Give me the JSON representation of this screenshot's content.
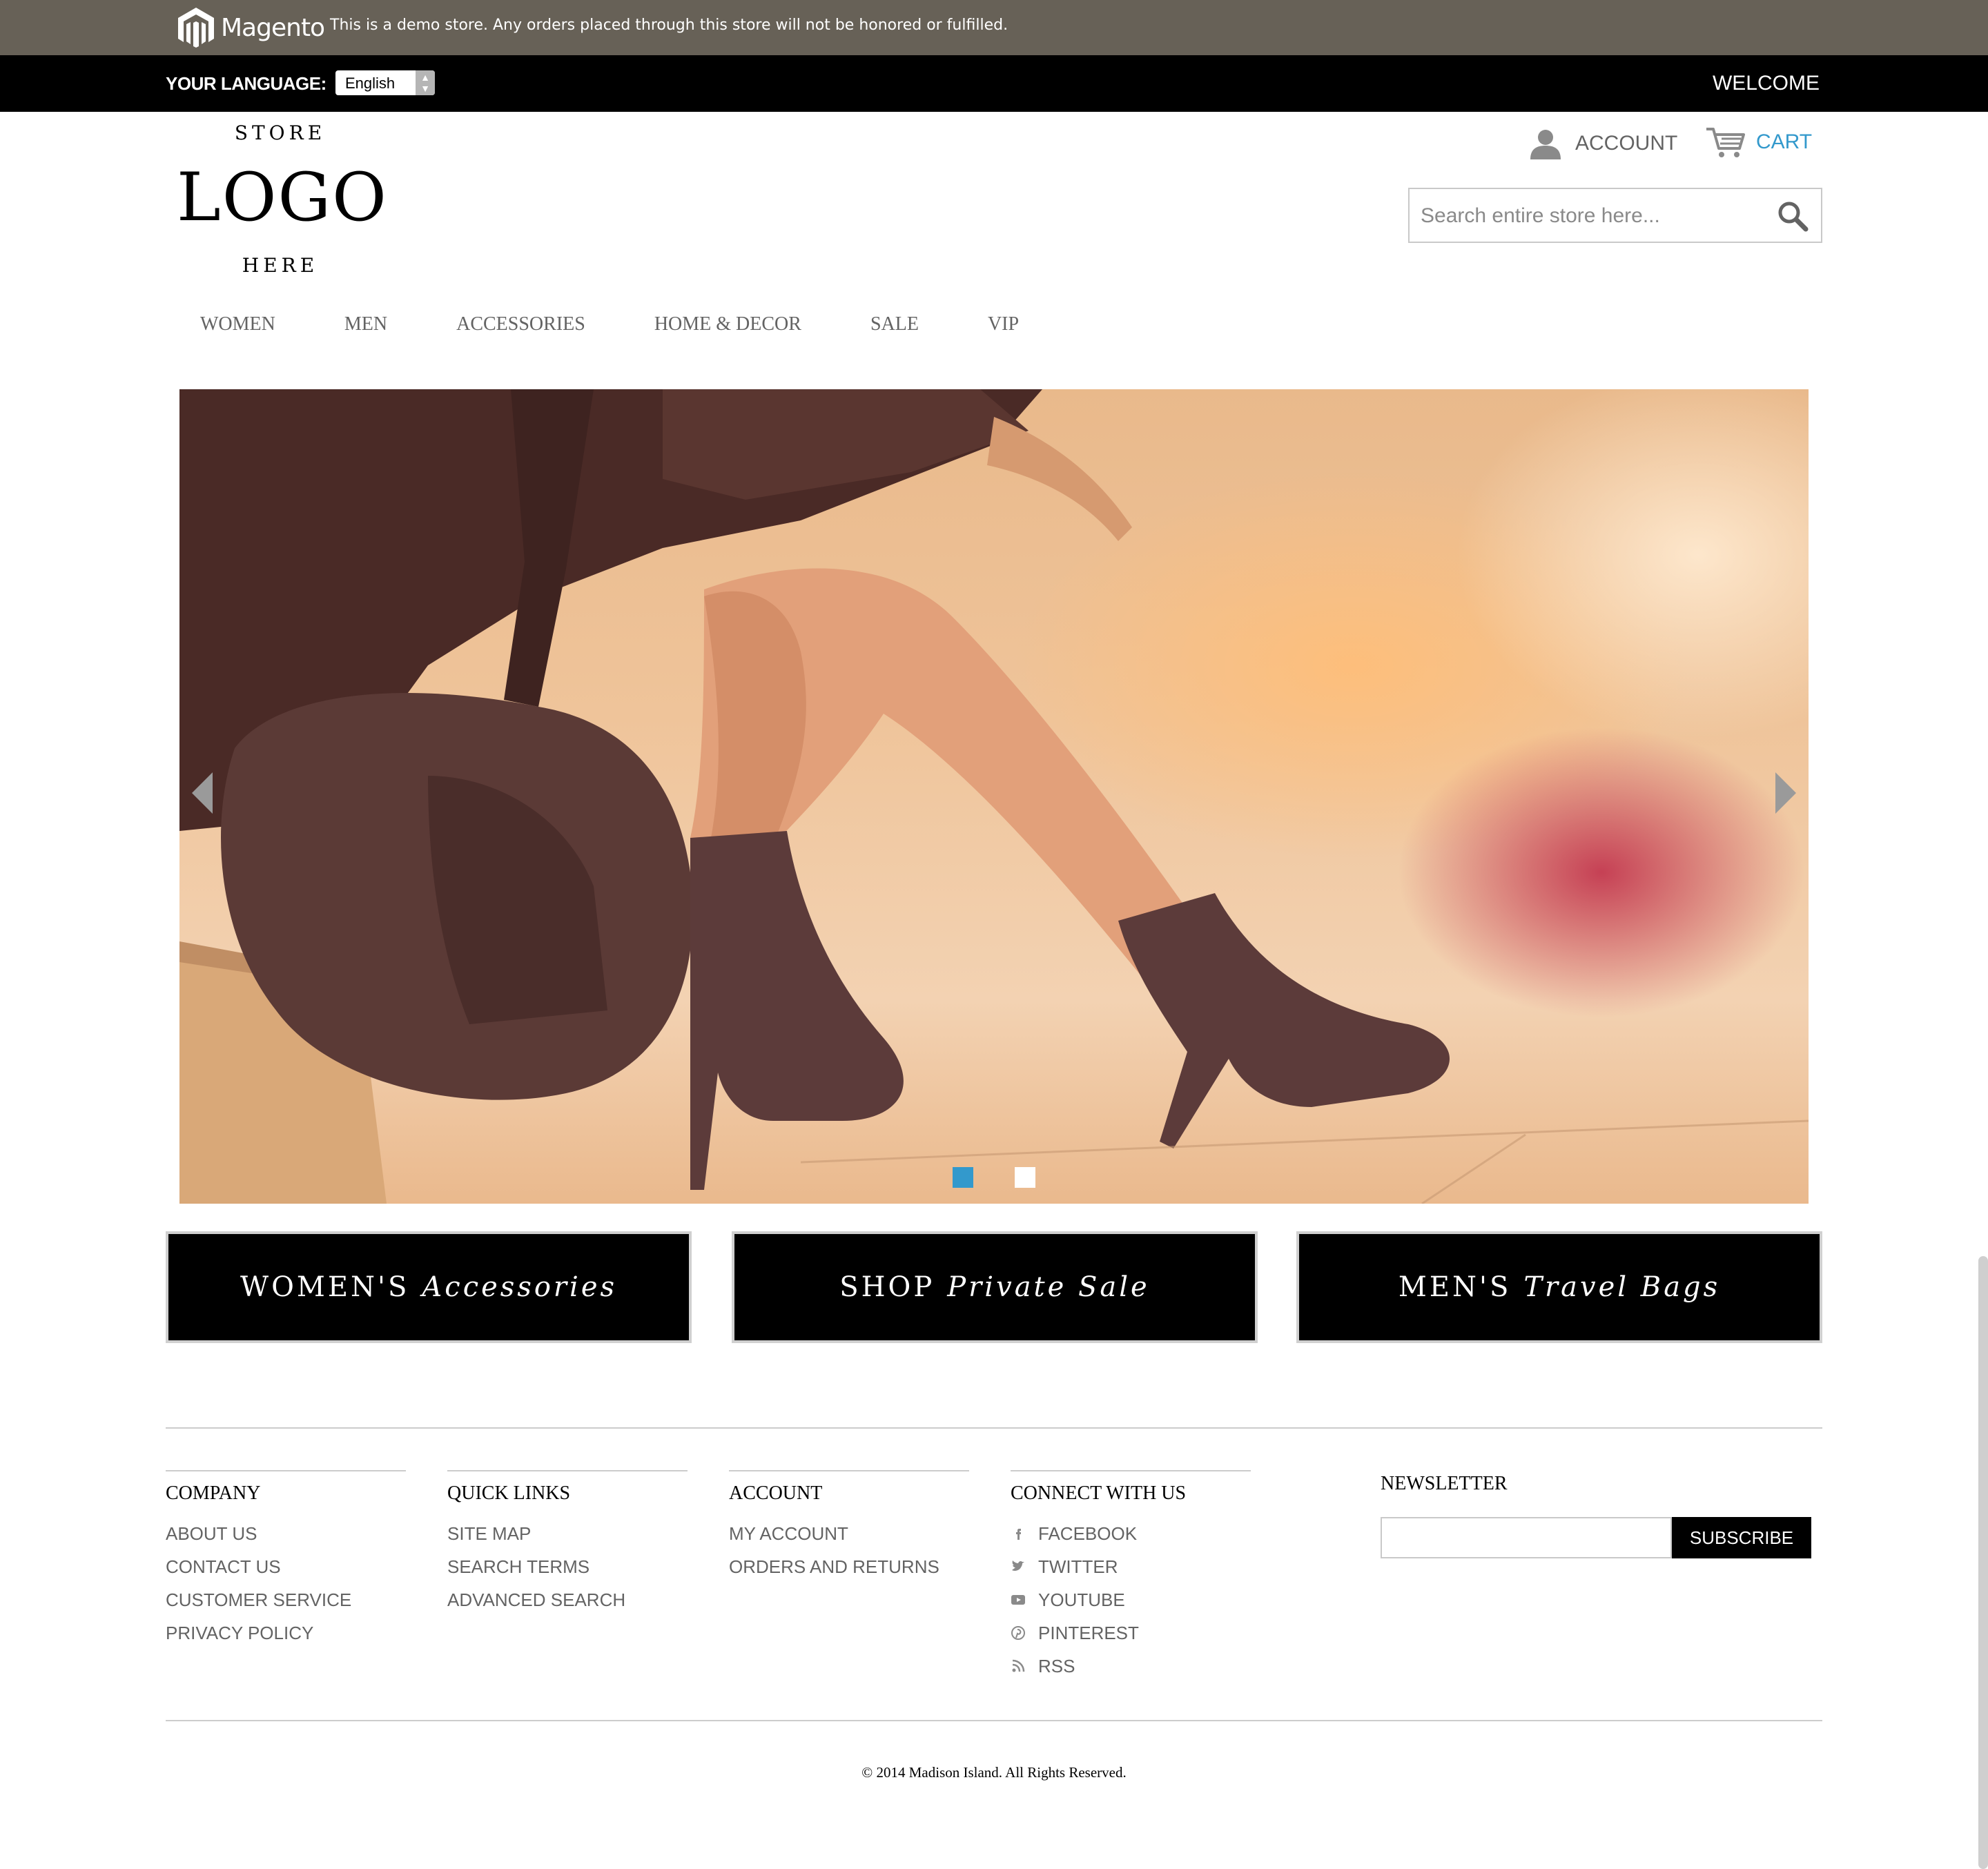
{
  "demo_notice": {
    "brand": "Magento",
    "text": "This is a demo store. Any orders placed through this store will not be honored or fulfilled."
  },
  "language_bar": {
    "label": "YOUR LANGUAGE:",
    "selected": "English",
    "welcome": "WELCOME"
  },
  "logo": {
    "line1": "STORE",
    "line2": "LOGO",
    "line3": "HERE"
  },
  "header": {
    "account_label": "ACCOUNT",
    "cart_label": "CART",
    "search_placeholder": "Search entire store here..."
  },
  "nav": [
    "WOMEN",
    "MEN",
    "ACCESSORIES",
    "HOME & DECOR",
    "SALE",
    "VIP"
  ],
  "slider": {
    "slide_count": 2,
    "active_slide": 1
  },
  "promos": [
    {
      "a": "WOMEN'S",
      "b": "Accessories"
    },
    {
      "a": "SHOP",
      "b": "Private Sale"
    },
    {
      "a": "MEN'S",
      "b": "Travel Bags"
    }
  ],
  "footer": {
    "company": {
      "title": "COMPANY",
      "links": [
        "ABOUT US",
        "CONTACT US",
        "CUSTOMER SERVICE",
        "PRIVACY POLICY"
      ]
    },
    "quick_links": {
      "title": "QUICK LINKS",
      "links": [
        "SITE MAP",
        "SEARCH TERMS",
        "ADVANCED SEARCH"
      ]
    },
    "account": {
      "title": "ACCOUNT",
      "links": [
        "MY ACCOUNT",
        "ORDERS AND RETURNS"
      ]
    },
    "connect": {
      "title": "CONNECT WITH US",
      "links": [
        {
          "label": "FACEBOOK",
          "icon": "facebook-icon"
        },
        {
          "label": "TWITTER",
          "icon": "twitter-icon"
        },
        {
          "label": "YOUTUBE",
          "icon": "youtube-icon"
        },
        {
          "label": "PINTEREST",
          "icon": "pinterest-icon"
        },
        {
          "label": "RSS",
          "icon": "rss-icon"
        }
      ]
    },
    "newsletter": {
      "title": "NEWSLETTER",
      "button": "SUBSCRIBE"
    },
    "copyright": "© 2014 Madison Island. All Rights Reserved."
  },
  "colors": {
    "demo_bar": "#676157",
    "accent": "#3399cc",
    "text": "#636363"
  }
}
